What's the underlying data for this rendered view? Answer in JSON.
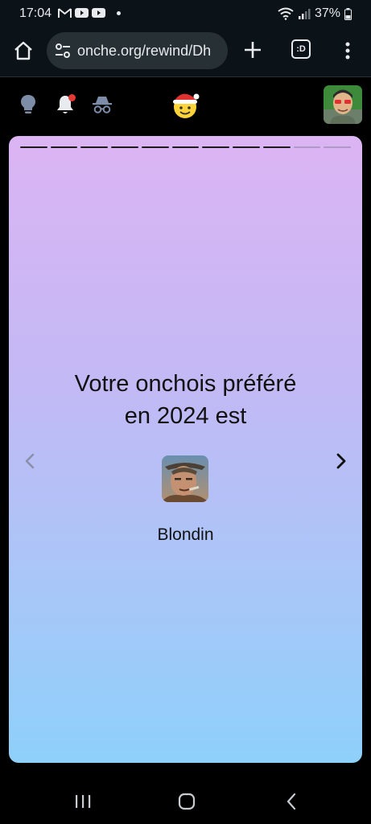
{
  "status_bar": {
    "time": "17:04",
    "battery": "37%",
    "left_icons": [
      "gmail-icon",
      "youtube-icon",
      "youtube-icon"
    ],
    "right_icons": [
      "wifi-icon",
      "signal-icon",
      "battery-icon"
    ]
  },
  "browser": {
    "url": "onche.org/rewind/Dh",
    "tabs_label": ":D"
  },
  "header": {
    "icons": [
      "lightbulb-icon",
      "bell-icon",
      "incognito-icon"
    ],
    "logo": "santa-smiley-logo",
    "notification_badge_color": "#e53935"
  },
  "story": {
    "progress_total": 11,
    "progress_done": 9,
    "title_line1": "Votre onchois préféré",
    "title_line2": "en 2024 est",
    "favorite_name": "Blondin",
    "gradient_top": "#dcb4f3",
    "gradient_bottom": "#8ed0fa"
  }
}
